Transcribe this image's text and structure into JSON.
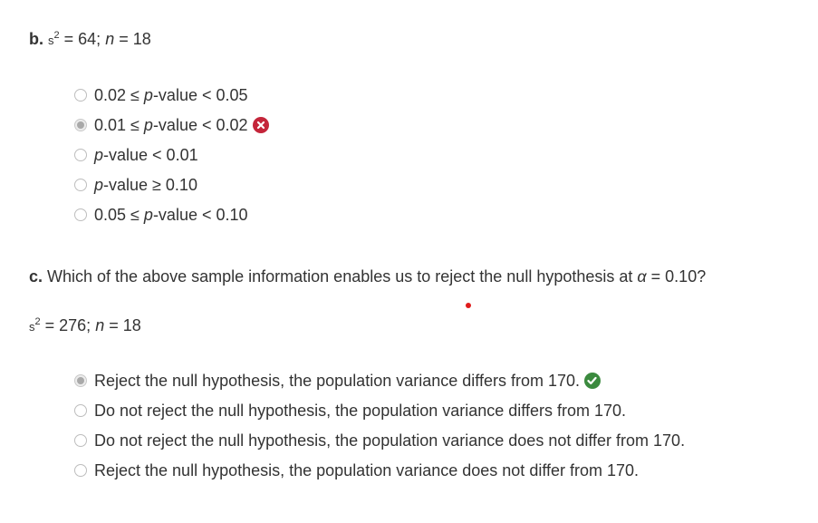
{
  "part_b": {
    "prefix": "b.",
    "stats": {
      "s": "s",
      "s_exp": "2",
      "s_val": " = 64; ",
      "n": "n",
      "n_val": " = 18"
    },
    "options": [
      {
        "pre": "0.02 ≤ ",
        "ital": "p",
        "post": "-value < 0.05",
        "selected": false,
        "feedback": ""
      },
      {
        "pre": "0.01 ≤ ",
        "ital": "p",
        "post": "-value < 0.02",
        "selected": true,
        "feedback": "incorrect"
      },
      {
        "pre": "",
        "ital": "p",
        "post": "-value < 0.01",
        "selected": false,
        "feedback": ""
      },
      {
        "pre": "",
        "ital": "p",
        "post": "-value ≥ 0.10",
        "selected": false,
        "feedback": ""
      },
      {
        "pre": "0.05 ≤ ",
        "ital": "p",
        "post": "-value < 0.10",
        "selected": false,
        "feedback": ""
      }
    ]
  },
  "part_c": {
    "prefix": "c.",
    "question_pre": " Which of the above sample information enables us to reject the null hypothesis at ",
    "alpha_symbol": "α",
    "question_post": " = 0.10?",
    "stats": {
      "s": "s",
      "s_exp": "2",
      "s_val": " = 276; ",
      "n": "n",
      "n_val": " = 18"
    },
    "options": [
      {
        "label": "Reject the null hypothesis, the population variance differs from 170.",
        "selected": true,
        "feedback": "correct"
      },
      {
        "label": "Do not reject the null hypothesis, the population variance differs from 170.",
        "selected": false,
        "feedback": ""
      },
      {
        "label": "Do not reject the null hypothesis, the population variance does not differ from 170.",
        "selected": false,
        "feedback": ""
      },
      {
        "label": "Reject the null hypothesis, the population variance does not differ from 170.",
        "selected": false,
        "feedback": ""
      }
    ]
  },
  "colors": {
    "incorrect_badge": "#c4253a",
    "correct_badge": "#3b8a3e",
    "text": "#333333"
  },
  "icons": {
    "incorrect": "x-mark-icon",
    "correct": "checkmark-icon"
  }
}
